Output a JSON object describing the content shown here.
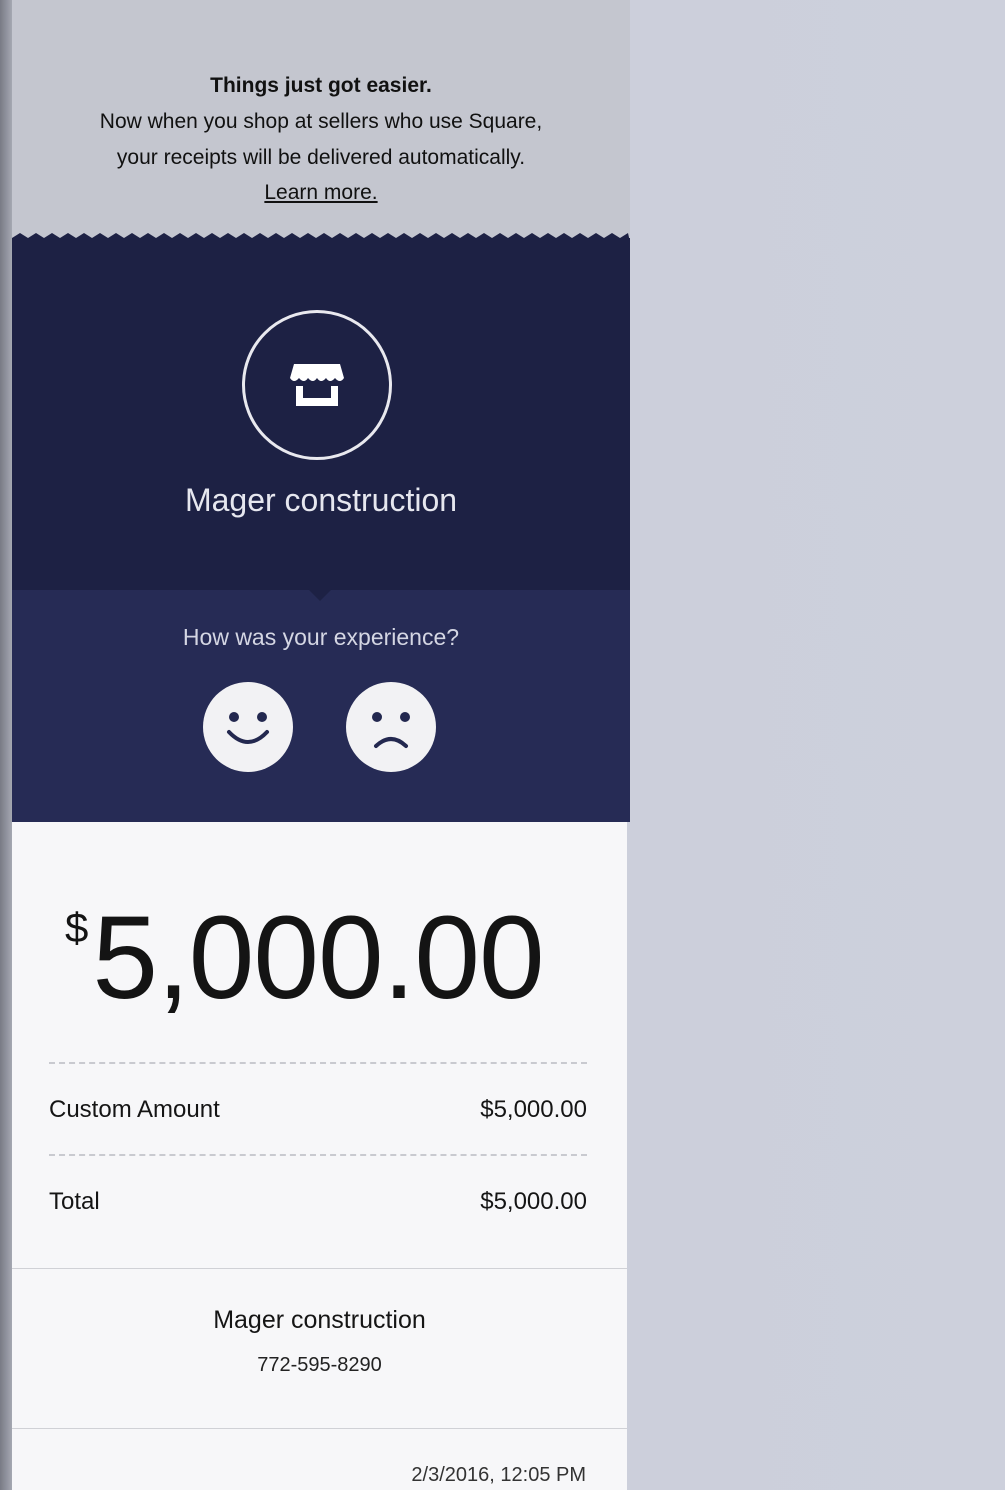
{
  "promo": {
    "title": "Things just got easier.",
    "line1": "Now when you shop at sellers who use Square,",
    "line2": "your receipts will be delivered automatically.",
    "link": "Learn more."
  },
  "merchant": {
    "icon": "storefront-icon",
    "name": "Mager construction"
  },
  "feedback": {
    "question": "How was your experience?",
    "positive_icon": "smiley-face-icon",
    "negative_icon": "frowny-face-icon"
  },
  "amount": {
    "currency": "$",
    "value": "5,000.00"
  },
  "line_items": [
    {
      "label": "Custom Amount",
      "value": "$5,000.00"
    }
  ],
  "total": {
    "label": "Total",
    "value": "$5,000.00"
  },
  "footer": {
    "name": "Mager construction",
    "phone": "772-595-8290",
    "datetime": "2/3/2016, 12:05 PM"
  },
  "colors": {
    "header_bg": "#1d2144",
    "feedback_bg": "#262b55",
    "page_bg": "#cdd0dc"
  }
}
